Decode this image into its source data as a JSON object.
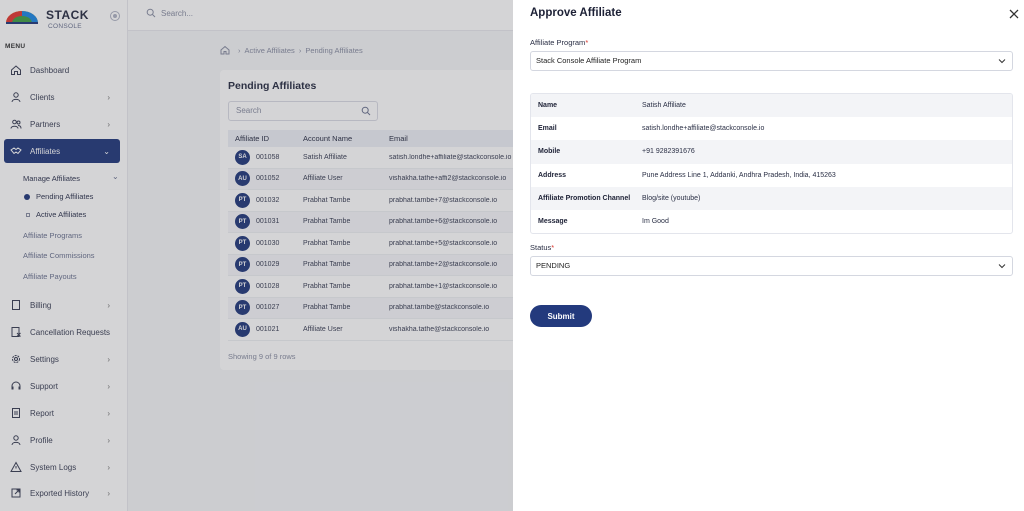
{
  "sidebar": {
    "logo_main": "STACK",
    "logo_sub": "CONSOLE",
    "menu_label": "MENU",
    "items": [
      {
        "label": "Dashboard"
      },
      {
        "label": "Clients"
      },
      {
        "label": "Partners"
      },
      {
        "label": "Affiliates"
      },
      {
        "label": "Billing"
      },
      {
        "label": "Cancellation Requests"
      },
      {
        "label": "Settings"
      },
      {
        "label": "Support"
      },
      {
        "label": "Report"
      },
      {
        "label": "Profile"
      },
      {
        "label": "System Logs"
      },
      {
        "label": "Exported History"
      }
    ],
    "affiliates_sub": {
      "manage": "Manage Affiliates",
      "pending": "Pending Affiliates",
      "active": "Active Affiliates",
      "programs": "Affiliate Programs",
      "commissions": "Affiliate Commissions",
      "payouts": "Affiliate Payouts"
    }
  },
  "topbar": {
    "search_placeholder": "Search..."
  },
  "breadcrumb": {
    "item1": "Active Affiliates",
    "item2": "Pending Affiliates"
  },
  "list": {
    "title": "Pending Affiliates",
    "search_placeholder": "Search",
    "columns": [
      "Affiliate ID",
      "Account Name",
      "Email"
    ],
    "rows": [
      {
        "initials": "SA",
        "id": "001058",
        "name": "Satish Affiliate",
        "email": "satish.londhe+affiliate@stackconsole.io"
      },
      {
        "initials": "AU",
        "id": "001052",
        "name": "Affiliate User",
        "email": "vishakha.tathe+affi2@stackconsole.io"
      },
      {
        "initials": "PT",
        "id": "001032",
        "name": "Prabhat Tambe",
        "email": "prabhat.tambe+7@stackconsole.io"
      },
      {
        "initials": "PT",
        "id": "001031",
        "name": "Prabhat Tambe",
        "email": "prabhat.tambe+6@stackconsole.io"
      },
      {
        "initials": "PT",
        "id": "001030",
        "name": "Prabhat Tambe",
        "email": "prabhat.tambe+5@stackconsole.io"
      },
      {
        "initials": "PT",
        "id": "001029",
        "name": "Prabhat Tambe",
        "email": "prabhat.tambe+2@stackconsole.io"
      },
      {
        "initials": "PT",
        "id": "001028",
        "name": "Prabhat Tambe",
        "email": "prabhat.tambe+1@stackconsole.io"
      },
      {
        "initials": "PT",
        "id": "001027",
        "name": "Prabhat Tambe",
        "email": "prabhat.tambe@stackconsole.io"
      },
      {
        "initials": "AU",
        "id": "001021",
        "name": "Affiliate User",
        "email": "vishakha.tathe@stackconsole.io"
      }
    ],
    "showing": "Showing 9 of 9 rows"
  },
  "drawer": {
    "title": "Approve Affiliate",
    "program_label": "Affiliate Program",
    "program_value": "Stack Console Affiliate Program",
    "required_mark": "*",
    "details": [
      {
        "key": "Name",
        "value": "Satish Affiliate"
      },
      {
        "key": "Email",
        "value": "satish.londhe+affiliate@stackconsole.io"
      },
      {
        "key": "Mobile",
        "value": "+91 9282391676"
      },
      {
        "key": "Address",
        "value": "Pune Address Line 1, Addanki, Andhra Pradesh, India, 415263"
      },
      {
        "key": "Affiliate Promotion Channel",
        "value": "Blog/site (youtube)"
      },
      {
        "key": "Message",
        "value": "Im Good"
      }
    ],
    "status_label": "Status",
    "status_value": "PENDING",
    "submit_label": "Submit"
  },
  "colors": {
    "brand": "#233a7d",
    "required": "#d9342b"
  }
}
